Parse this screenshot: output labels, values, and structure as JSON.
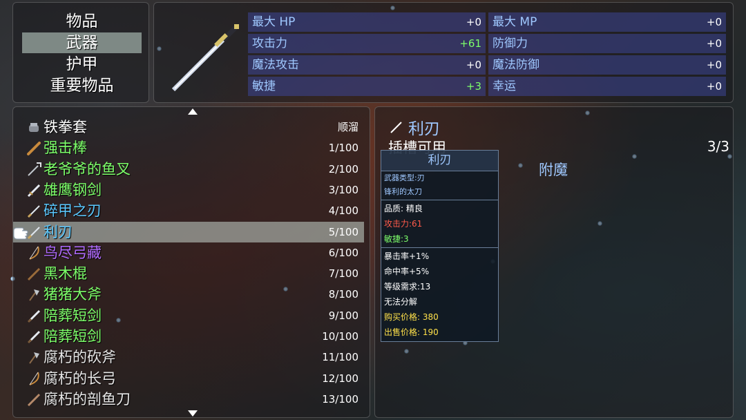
{
  "categories": [
    {
      "label": "物品"
    },
    {
      "label": "武器"
    },
    {
      "label": "护甲"
    },
    {
      "label": "重要物品"
    }
  ],
  "stats": [
    {
      "label": "最大 HP",
      "value": "+0"
    },
    {
      "label": "最大 MP",
      "value": "+0"
    },
    {
      "label": "攻击力",
      "value": "+61"
    },
    {
      "label": "防御力",
      "value": "+0"
    },
    {
      "label": "魔法攻击",
      "value": "+0"
    },
    {
      "label": "魔法防御",
      "value": "+0"
    },
    {
      "label": "敏捷",
      "value": "+3"
    },
    {
      "label": "幸运",
      "value": "+0"
    }
  ],
  "items": [
    {
      "name": "铁拳套",
      "count": "顺溜",
      "color": "#ffffff",
      "icon": "gauntlet-icon"
    },
    {
      "name": "强击棒",
      "count": "1/100",
      "color": "#7dff6a",
      "icon": "club-icon"
    },
    {
      "name": "老爷爷的鱼叉",
      "count": "2/100",
      "color": "#7dff6a",
      "icon": "harpoon-icon"
    },
    {
      "name": "雄鹰钢剑",
      "count": "3/100",
      "color": "#7dff6a",
      "icon": "sword-icon"
    },
    {
      "name": "碎甲之刃",
      "count": "4/100",
      "color": "#5ac8ff",
      "icon": "blade-icon"
    },
    {
      "name": "利刃",
      "count": "5/100",
      "color": "#5ac8ff",
      "icon": "blade-icon"
    },
    {
      "name": "鸟尽弓藏",
      "count": "6/100",
      "color": "#b06bff",
      "icon": "bow-icon"
    },
    {
      "name": "黑木棍",
      "count": "7/100",
      "color": "#7dff6a",
      "icon": "staff-icon"
    },
    {
      "name": "猪猪大斧",
      "count": "8/100",
      "color": "#7dff6a",
      "icon": "axe-icon"
    },
    {
      "name": "陪葬短剑",
      "count": "9/100",
      "color": "#7dff6a",
      "icon": "dagger-icon"
    },
    {
      "name": "陪葬短剑",
      "count": "10/100",
      "color": "#7dff6a",
      "icon": "dagger-icon"
    },
    {
      "name": "腐朽的砍斧",
      "count": "11/100",
      "color": "#e6e6e6",
      "icon": "axe-icon"
    },
    {
      "name": "腐朽的长弓",
      "count": "12/100",
      "color": "#e6e6e6",
      "icon": "bow-icon"
    },
    {
      "name": "腐朽的剖鱼刀",
      "count": "13/100",
      "color": "#e6e6e6",
      "icon": "knife-icon"
    }
  ],
  "detail": {
    "name": "利刃",
    "slot_label": "插槽可用",
    "slot_count": "3/3",
    "enchant_label": "附魔"
  },
  "tooltip": {
    "title": "利刃",
    "weapon_type": "武器类型:刃",
    "description": "锋利的太刀",
    "quality": "品质: 精良",
    "attack": "攻击力:61",
    "agility": "敏捷:3",
    "crit": "暴击率+1%",
    "hit": "命中率+5%",
    "level_req": "等级需求:13",
    "disassemble": "无法分解",
    "buy_price": "购买价格: 380",
    "sell_price": "出售价格: 190"
  },
  "colors": {
    "label_blue": "#9fc8ff",
    "increase_green": "#7dff6a",
    "attack_red": "#ff5a4a",
    "price_yellow": "#ffe14a",
    "stat_bar": "#3c4696"
  }
}
